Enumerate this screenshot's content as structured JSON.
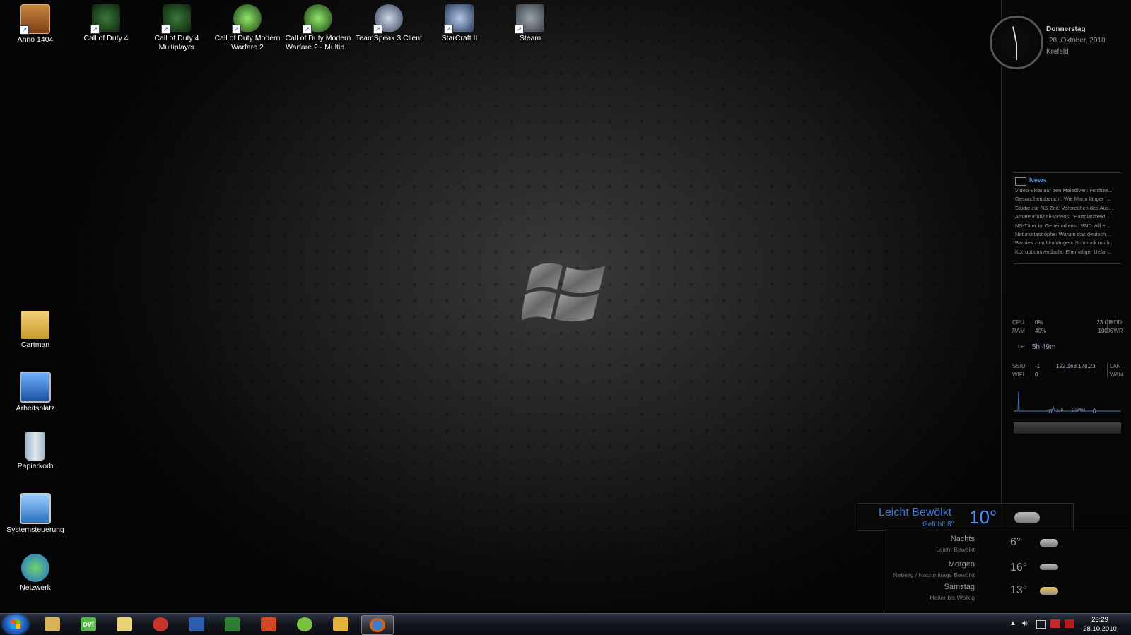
{
  "desktop": {
    "top_icons": [
      {
        "label": "Anno 1404"
      },
      {
        "label": "Call of Duty 4"
      },
      {
        "label": "Call of Duty 4 Multiplayer"
      },
      {
        "label": "Call of Duty Modern Warfare 2"
      },
      {
        "label": "Call of Duty Modern Warfare 2 - Multip..."
      },
      {
        "label": "TeamSpeak 3 Client"
      },
      {
        "label": "StarCraft II"
      },
      {
        "label": "Steam"
      }
    ],
    "left_icons": [
      {
        "label": "Cartman"
      },
      {
        "label": "Arbeitsplatz"
      },
      {
        "label": "Papierkorb"
      },
      {
        "label": "Systemsteuerung"
      },
      {
        "label": "Netzwerk"
      }
    ]
  },
  "clock_gadget": {
    "day": "Donnerstag",
    "date": "28. Oktober, 2010",
    "city": "Krefeld"
  },
  "news_gadget": {
    "title": "News",
    "items": [
      "Video-Eklat auf den Malediven: Hochze...",
      "Gesundheitsbericht: Wie Mann länger l...",
      "Studie zur NS-Zeit: Verbrechen des Aus...",
      "Amateurfußball-Videos: \"Hartplatzheld...",
      "NS-Täter im Geheimdienst: BND will el...",
      "Naturkatastrophe: Warum das deutsch...",
      "Barbies zum Umhängen: Schmuck mich...",
      "Korruptionsverdacht: Ehemaliger Uefa-..."
    ]
  },
  "system_gadget": {
    "cpu_label": "CPU",
    "cpu_value": "0%",
    "ram_label": "RAM",
    "ram_value": "40%",
    "hdd_value": "23 GB",
    "hdd_label": "HDD",
    "pwr_value": "100%",
    "pwr_label": "PWR",
    "up_label": "UP",
    "uptime": "5h 49m",
    "ssid_label": "SSID",
    "ssid_value": "-1",
    "wifi_label": "WIFI",
    "wifi_value": "0",
    "ip": "192.168.178.23",
    "lan_label": "LAN",
    "wan_label": "WAN",
    "up_rate": "0",
    "up_small": "UP",
    "down_small": "DOWN",
    "down_rate": "0"
  },
  "weather_gadget": {
    "condition": "Leicht Bewölkt",
    "feels_like": "Gefühlt 8°",
    "temperature": "10°",
    "forecast": [
      {
        "name": "Nachts",
        "desc": "Leicht Bewölkt",
        "temp": "6°"
      },
      {
        "name": "Morgen",
        "desc": "Nebelig / Nachmittags Bewölkt",
        "temp": "16°"
      },
      {
        "name": "Samstag",
        "desc": "Heiter bis Wolkig",
        "temp": "13°"
      }
    ]
  },
  "taskbar": {
    "pinned": [
      {
        "icon": "windows-explorer-icon",
        "color": "#d9b25a"
      },
      {
        "icon": "ovi-icon",
        "color": "#5ab54a",
        "text": "ovi"
      },
      {
        "icon": "media-icon",
        "color": "#c9342f"
      },
      {
        "icon": "word-icon",
        "color": "#2b5fad"
      },
      {
        "icon": "excel-icon",
        "color": "#2e7d32"
      },
      {
        "icon": "powerpoint-icon",
        "color": "#d24726"
      },
      {
        "icon": "icq-icon",
        "color": "#7ac143"
      },
      {
        "icon": "mail-icon",
        "color": "#e3b23c"
      },
      {
        "icon": "firefox-icon",
        "color": "#e66000"
      }
    ],
    "time": "23:29",
    "date": "28.10.2010"
  }
}
